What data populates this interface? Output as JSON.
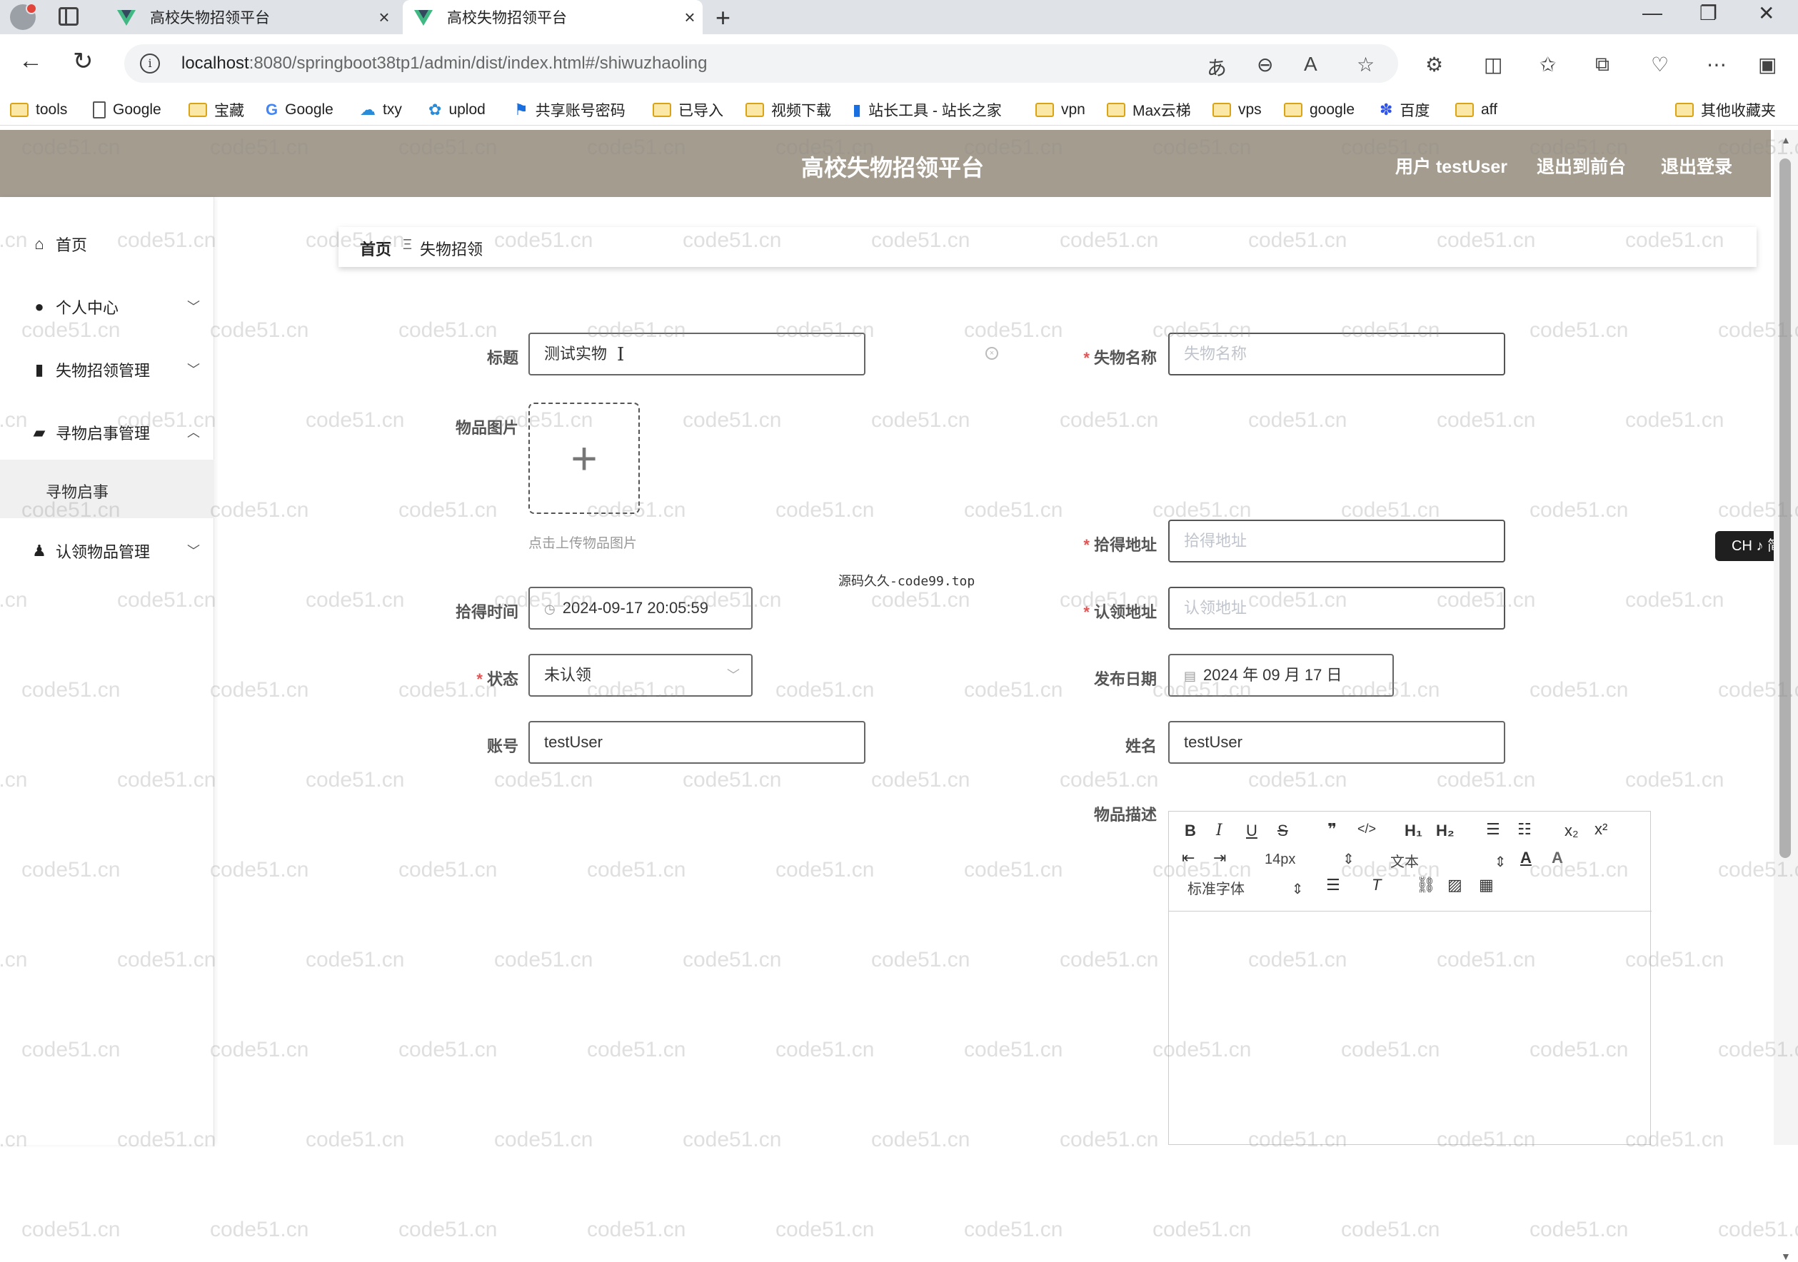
{
  "browser": {
    "tabs": [
      {
        "title": "高校失物招领平台",
        "active": false
      },
      {
        "title": "高校失物招领平台",
        "active": true
      }
    ],
    "url_host": "localhost",
    "url_rest": ":8080/springboot38tp1/admin/dist/index.html#/shiwuzhaoling",
    "bookmarks": [
      "tools",
      "Google",
      "宝藏",
      "Google",
      "txy",
      "uplod",
      "共享账号密码",
      "已导入",
      "视频下载",
      "站长工具 - 站长之家",
      "vpn",
      "Max云梯",
      "vps",
      "google",
      "百度",
      "aff"
    ],
    "other_bookmarks": "其他收藏夹"
  },
  "header": {
    "title": "高校失物招领平台",
    "user": "用户 testUser",
    "back_front": "退出到前台",
    "logout": "退出登录"
  },
  "sidebar": {
    "items": [
      {
        "label": "首页",
        "icon": "home-icon"
      },
      {
        "label": "个人中心",
        "icon": "user-icon"
      },
      {
        "label": "失物招领管理",
        "icon": "chart-icon"
      },
      {
        "label": "寻物启事管理",
        "icon": "wallet-icon"
      },
      {
        "label": "认领物品管理",
        "icon": "person-icon"
      }
    ],
    "submenu": "寻物启事"
  },
  "breadcrumb": {
    "home": "首页",
    "current": "失物招领"
  },
  "form": {
    "title_label": "标题",
    "title_value": "测试实物",
    "name_label": "失物名称",
    "name_placeholder": "失物名称",
    "image_label": "物品图片",
    "image_hint": "点击上传物品图片",
    "found_addr_label": "拾得地址",
    "found_addr_placeholder": "拾得地址",
    "found_time_label": "拾得时间",
    "found_time_value": "2024-09-17 20:05:59",
    "claim_addr_label": "认领地址",
    "claim_addr_placeholder": "认领地址",
    "status_label": "状态",
    "status_value": "未认领",
    "publish_label": "发布日期",
    "publish_value": "2024 年 09 月 17 日",
    "account_label": "账号",
    "account_value": "testUser",
    "username_label": "姓名",
    "username_value": "testUser",
    "desc_label": "物品描述"
  },
  "editor": {
    "font_size": "14px",
    "block": "文本",
    "font": "标准字体"
  },
  "overlay": {
    "source_text": "源码久久-code99.top",
    "ime": "CH ♪ 简"
  },
  "watermark": "code51.cn"
}
